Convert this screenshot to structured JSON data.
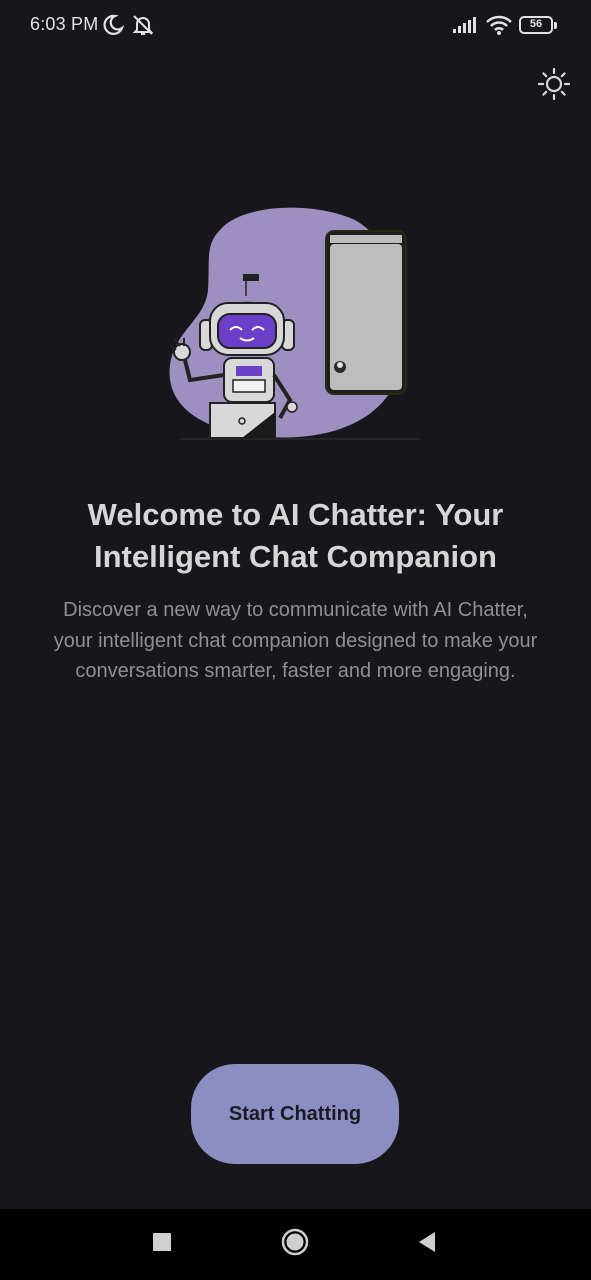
{
  "status_bar": {
    "time": "6:03 PM",
    "battery_level": "56",
    "icons": [
      "moon-icon",
      "mute-icon",
      "signal-icon",
      "wifi-icon",
      "battery-icon"
    ]
  },
  "header": {
    "theme_toggle_icon": "sun-icon"
  },
  "illustration": {
    "description_icon": "robot-chat-illustration",
    "colors": {
      "blob": "#9d8fc0",
      "robot_face": "#6b3fc8",
      "phone_screen": "#bdbdbd"
    }
  },
  "welcome": {
    "title": "Welcome to AI Chatter: Your Intelligent Chat Companion",
    "body": "Discover a new way to communicate with AI Chatter, your intelligent chat companion designed to make your conversations smarter, faster and more engaging."
  },
  "cta": {
    "label": "Start Chatting",
    "color": "#8b8ec2"
  },
  "nav_bar": {
    "icons": [
      "recent-apps-icon",
      "home-icon",
      "back-icon"
    ]
  },
  "theme": {
    "background": "#17161b",
    "title_color": "#d6d6d6",
    "body_color": "#8f8f94"
  }
}
